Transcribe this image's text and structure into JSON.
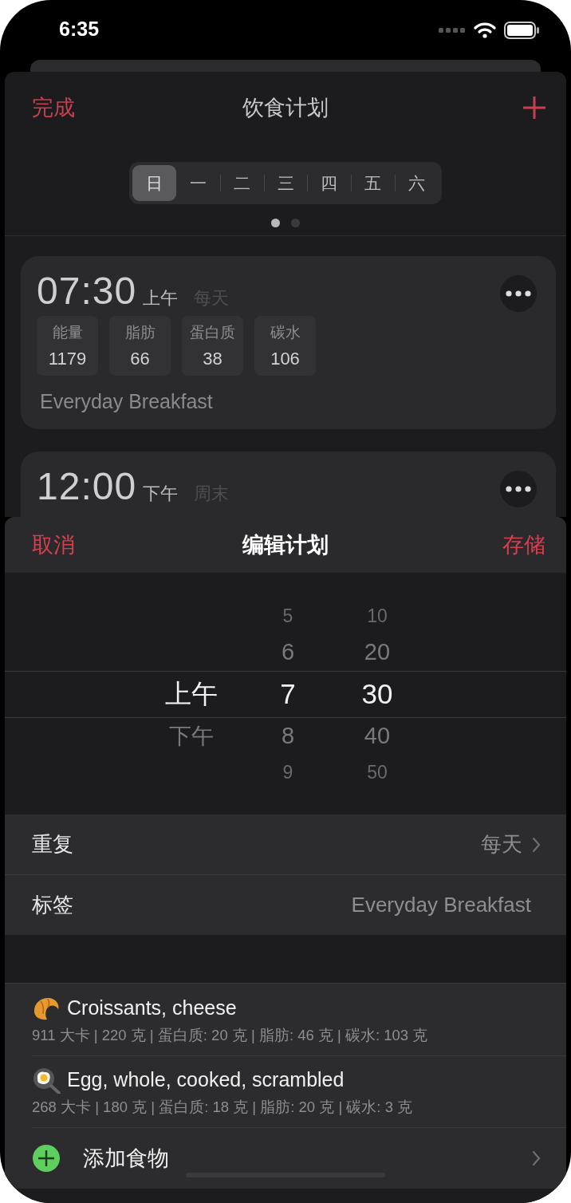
{
  "status_bar": {
    "time": "6:35"
  },
  "plan": {
    "done": "完成",
    "title": "饮食计划",
    "days": [
      {
        "label": "日",
        "selected": true
      },
      {
        "label": "一",
        "selected": false
      },
      {
        "label": "二",
        "selected": false
      },
      {
        "label": "三",
        "selected": false
      },
      {
        "label": "四",
        "selected": false
      },
      {
        "label": "五",
        "selected": false
      },
      {
        "label": "六",
        "selected": false
      }
    ],
    "pages": [
      {
        "selected": true
      },
      {
        "selected": false
      }
    ],
    "meals": [
      {
        "time": "07:30",
        "period": "上午",
        "repeat": "每天",
        "nutrients": [
          {
            "label": "能量",
            "value": "1179"
          },
          {
            "label": "脂肪",
            "value": "66"
          },
          {
            "label": "蛋白质",
            "value": "38"
          },
          {
            "label": "碳水",
            "value": "106"
          }
        ],
        "tag": "Everyday Breakfast"
      },
      {
        "time": "12:00",
        "period": "下午",
        "repeat": "周末"
      }
    ]
  },
  "editor": {
    "cancel": "取消",
    "title": "编辑计划",
    "save": "存储",
    "picker": [
      {
        "kind": "period",
        "items": [
          {
            "label": "上午",
            "selected": true
          },
          {
            "label": "下午",
            "selected": false
          }
        ]
      },
      {
        "kind": "hour",
        "items": [
          {
            "label": "5",
            "selected": false
          },
          {
            "label": "6",
            "selected": false
          },
          {
            "label": "7",
            "selected": true
          },
          {
            "label": "8",
            "selected": false
          },
          {
            "label": "9",
            "selected": false
          }
        ]
      },
      {
        "kind": "minute",
        "items": [
          {
            "label": "10",
            "selected": false
          },
          {
            "label": "20",
            "selected": false
          },
          {
            "label": "30",
            "selected": true
          },
          {
            "label": "40",
            "selected": false
          },
          {
            "label": "50",
            "selected": false
          }
        ]
      }
    ],
    "settings": [
      {
        "label": "重复",
        "value": "每天",
        "chevron": true
      },
      {
        "label": "标签",
        "value": "Everyday Breakfast",
        "chevron": false
      }
    ],
    "foods": [
      {
        "kind": "croissant",
        "name": "Croissants, cheese",
        "detail": "911 大卡 | 220 克 | 蛋白质: 20 克 | 脂肪: 46 克 | 碳水: 103 克"
      },
      {
        "kind": "egg",
        "name": "Egg, whole, cooked, scrambled",
        "detail": "268 大卡 | 180 克 | 蛋白质: 18 克 | 脂肪: 20 克 | 碳水: 3 克"
      }
    ],
    "add_food": "添加食物"
  }
}
